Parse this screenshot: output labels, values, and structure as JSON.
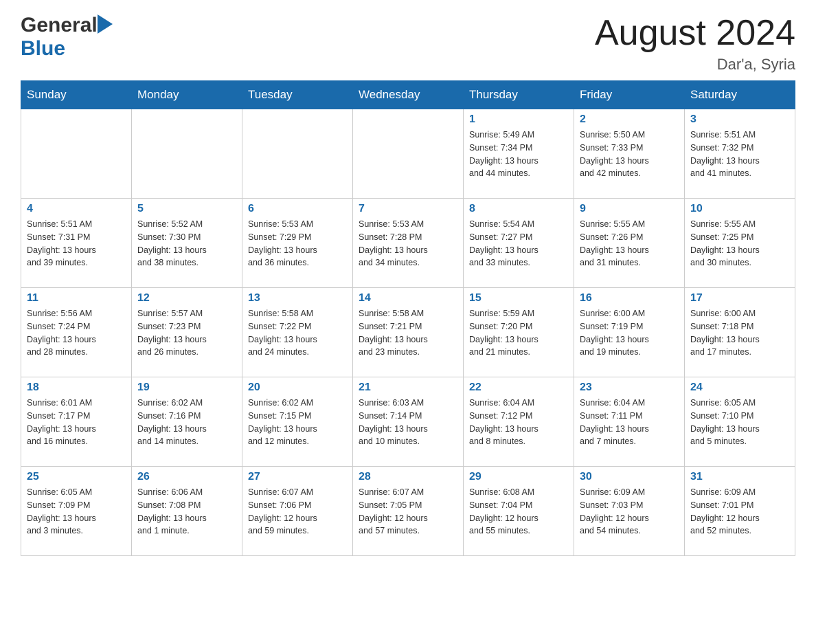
{
  "header": {
    "logo_general": "General",
    "logo_blue": "Blue",
    "title": "August 2024",
    "subtitle": "Dar'a, Syria"
  },
  "calendar": {
    "days_of_week": [
      "Sunday",
      "Monday",
      "Tuesday",
      "Wednesday",
      "Thursday",
      "Friday",
      "Saturday"
    ],
    "weeks": [
      {
        "days": [
          {
            "num": "",
            "info": ""
          },
          {
            "num": "",
            "info": ""
          },
          {
            "num": "",
            "info": ""
          },
          {
            "num": "",
            "info": ""
          },
          {
            "num": "1",
            "info": "Sunrise: 5:49 AM\nSunset: 7:34 PM\nDaylight: 13 hours\nand 44 minutes."
          },
          {
            "num": "2",
            "info": "Sunrise: 5:50 AM\nSunset: 7:33 PM\nDaylight: 13 hours\nand 42 minutes."
          },
          {
            "num": "3",
            "info": "Sunrise: 5:51 AM\nSunset: 7:32 PM\nDaylight: 13 hours\nand 41 minutes."
          }
        ]
      },
      {
        "days": [
          {
            "num": "4",
            "info": "Sunrise: 5:51 AM\nSunset: 7:31 PM\nDaylight: 13 hours\nand 39 minutes."
          },
          {
            "num": "5",
            "info": "Sunrise: 5:52 AM\nSunset: 7:30 PM\nDaylight: 13 hours\nand 38 minutes."
          },
          {
            "num": "6",
            "info": "Sunrise: 5:53 AM\nSunset: 7:29 PM\nDaylight: 13 hours\nand 36 minutes."
          },
          {
            "num": "7",
            "info": "Sunrise: 5:53 AM\nSunset: 7:28 PM\nDaylight: 13 hours\nand 34 minutes."
          },
          {
            "num": "8",
            "info": "Sunrise: 5:54 AM\nSunset: 7:27 PM\nDaylight: 13 hours\nand 33 minutes."
          },
          {
            "num": "9",
            "info": "Sunrise: 5:55 AM\nSunset: 7:26 PM\nDaylight: 13 hours\nand 31 minutes."
          },
          {
            "num": "10",
            "info": "Sunrise: 5:55 AM\nSunset: 7:25 PM\nDaylight: 13 hours\nand 30 minutes."
          }
        ]
      },
      {
        "days": [
          {
            "num": "11",
            "info": "Sunrise: 5:56 AM\nSunset: 7:24 PM\nDaylight: 13 hours\nand 28 minutes."
          },
          {
            "num": "12",
            "info": "Sunrise: 5:57 AM\nSunset: 7:23 PM\nDaylight: 13 hours\nand 26 minutes."
          },
          {
            "num": "13",
            "info": "Sunrise: 5:58 AM\nSunset: 7:22 PM\nDaylight: 13 hours\nand 24 minutes."
          },
          {
            "num": "14",
            "info": "Sunrise: 5:58 AM\nSunset: 7:21 PM\nDaylight: 13 hours\nand 23 minutes."
          },
          {
            "num": "15",
            "info": "Sunrise: 5:59 AM\nSunset: 7:20 PM\nDaylight: 13 hours\nand 21 minutes."
          },
          {
            "num": "16",
            "info": "Sunrise: 6:00 AM\nSunset: 7:19 PM\nDaylight: 13 hours\nand 19 minutes."
          },
          {
            "num": "17",
            "info": "Sunrise: 6:00 AM\nSunset: 7:18 PM\nDaylight: 13 hours\nand 17 minutes."
          }
        ]
      },
      {
        "days": [
          {
            "num": "18",
            "info": "Sunrise: 6:01 AM\nSunset: 7:17 PM\nDaylight: 13 hours\nand 16 minutes."
          },
          {
            "num": "19",
            "info": "Sunrise: 6:02 AM\nSunset: 7:16 PM\nDaylight: 13 hours\nand 14 minutes."
          },
          {
            "num": "20",
            "info": "Sunrise: 6:02 AM\nSunset: 7:15 PM\nDaylight: 13 hours\nand 12 minutes."
          },
          {
            "num": "21",
            "info": "Sunrise: 6:03 AM\nSunset: 7:14 PM\nDaylight: 13 hours\nand 10 minutes."
          },
          {
            "num": "22",
            "info": "Sunrise: 6:04 AM\nSunset: 7:12 PM\nDaylight: 13 hours\nand 8 minutes."
          },
          {
            "num": "23",
            "info": "Sunrise: 6:04 AM\nSunset: 7:11 PM\nDaylight: 13 hours\nand 7 minutes."
          },
          {
            "num": "24",
            "info": "Sunrise: 6:05 AM\nSunset: 7:10 PM\nDaylight: 13 hours\nand 5 minutes."
          }
        ]
      },
      {
        "days": [
          {
            "num": "25",
            "info": "Sunrise: 6:05 AM\nSunset: 7:09 PM\nDaylight: 13 hours\nand 3 minutes."
          },
          {
            "num": "26",
            "info": "Sunrise: 6:06 AM\nSunset: 7:08 PM\nDaylight: 13 hours\nand 1 minute."
          },
          {
            "num": "27",
            "info": "Sunrise: 6:07 AM\nSunset: 7:06 PM\nDaylight: 12 hours\nand 59 minutes."
          },
          {
            "num": "28",
            "info": "Sunrise: 6:07 AM\nSunset: 7:05 PM\nDaylight: 12 hours\nand 57 minutes."
          },
          {
            "num": "29",
            "info": "Sunrise: 6:08 AM\nSunset: 7:04 PM\nDaylight: 12 hours\nand 55 minutes."
          },
          {
            "num": "30",
            "info": "Sunrise: 6:09 AM\nSunset: 7:03 PM\nDaylight: 12 hours\nand 54 minutes."
          },
          {
            "num": "31",
            "info": "Sunrise: 6:09 AM\nSunset: 7:01 PM\nDaylight: 12 hours\nand 52 minutes."
          }
        ]
      }
    ]
  }
}
